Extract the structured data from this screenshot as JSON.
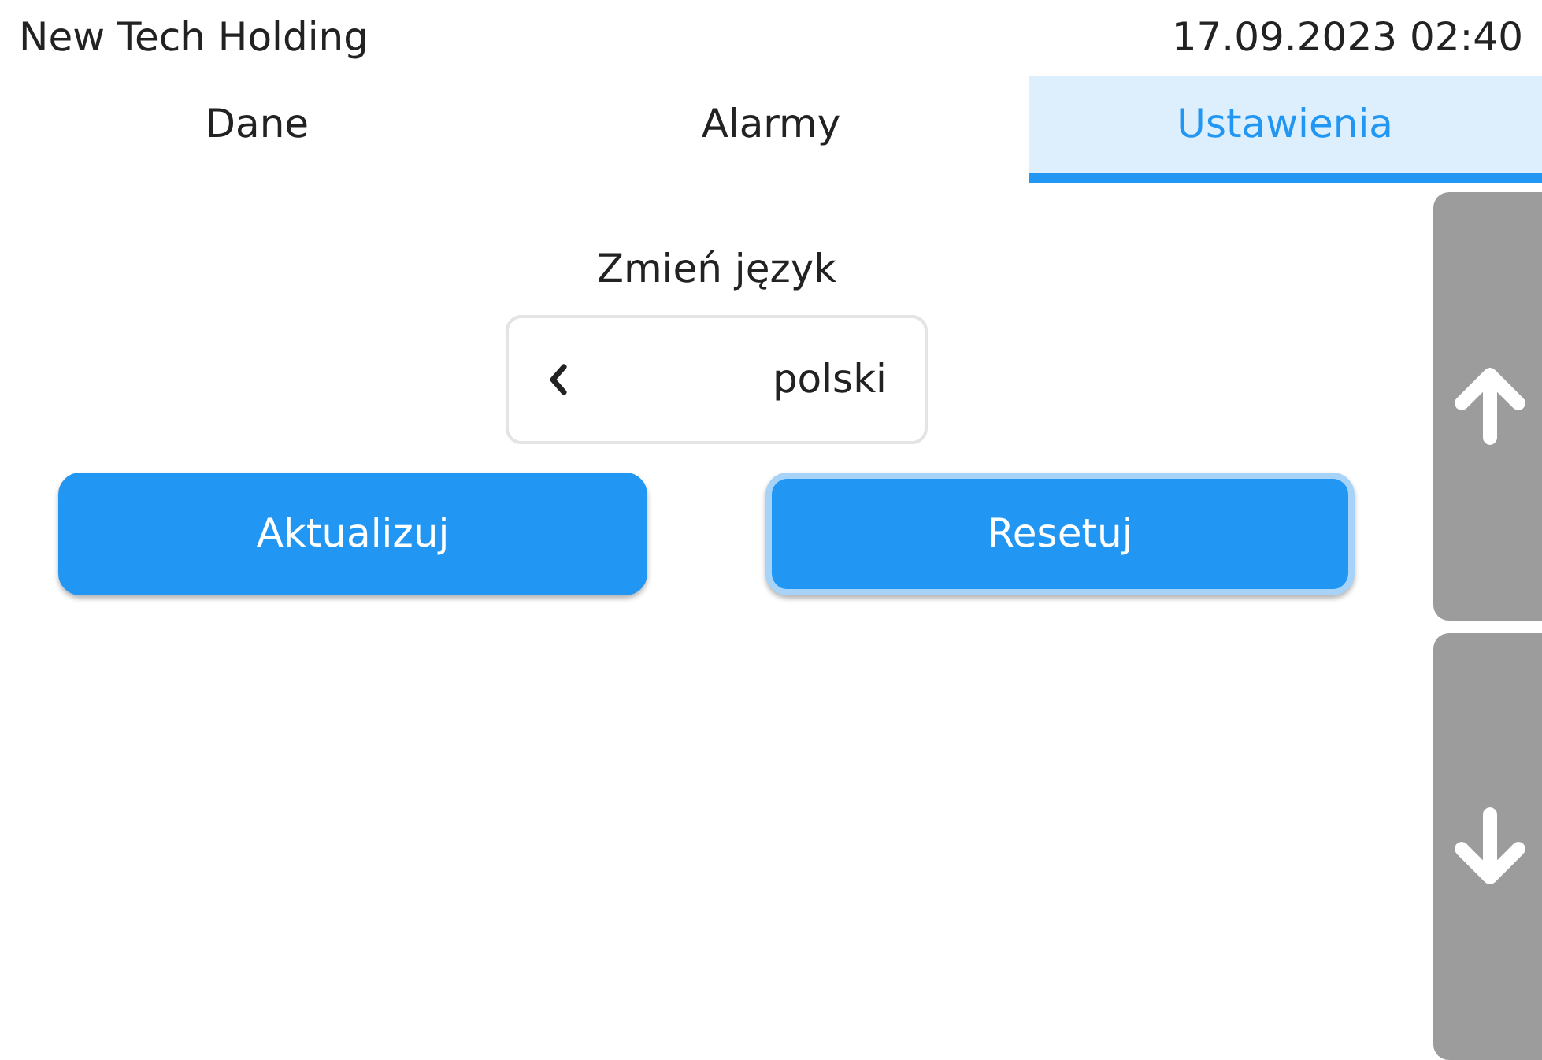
{
  "header": {
    "title": "New Tech Holding",
    "datetime": "17.09.2023 02:40"
  },
  "tabs": [
    {
      "label": "Dane",
      "selected": false
    },
    {
      "label": "Alarmy",
      "selected": false
    },
    {
      "label": "Ustawienia",
      "selected": true
    }
  ],
  "language": {
    "title": "Zmień język",
    "value": "polski"
  },
  "buttons": [
    {
      "label": "Aktualizuj",
      "focused": false
    },
    {
      "label": "Resetuj",
      "focused": true
    }
  ],
  "scroll_buttons": [
    {
      "kind": "up"
    },
    {
      "kind": "down"
    }
  ]
}
